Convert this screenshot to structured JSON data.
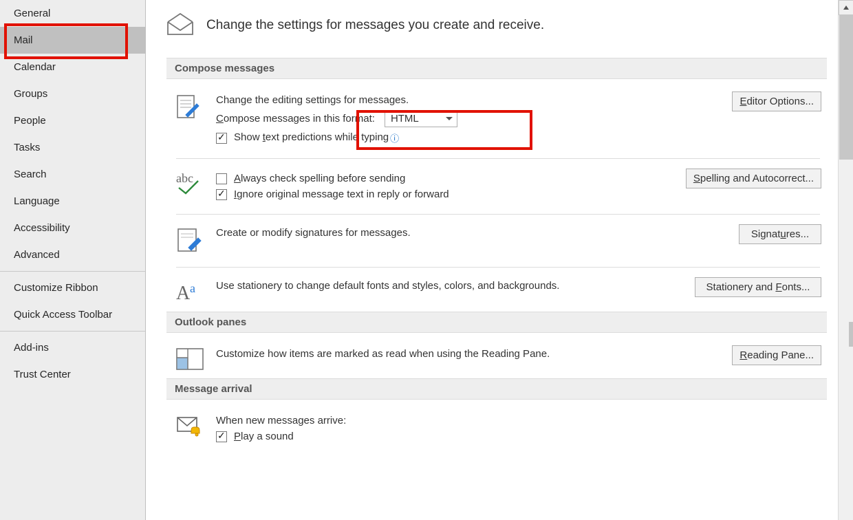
{
  "sidebar": {
    "items": [
      {
        "label": "General"
      },
      {
        "label": "Mail"
      },
      {
        "label": "Calendar"
      },
      {
        "label": "Groups"
      },
      {
        "label": "People"
      },
      {
        "label": "Tasks"
      },
      {
        "label": "Search"
      },
      {
        "label": "Language"
      },
      {
        "label": "Accessibility"
      },
      {
        "label": "Advanced"
      }
    ],
    "items2": [
      {
        "label": "Customize Ribbon"
      },
      {
        "label": "Quick Access Toolbar"
      }
    ],
    "items3": [
      {
        "label": "Add-ins"
      },
      {
        "label": "Trust Center"
      }
    ],
    "selected": "Mail"
  },
  "header": {
    "title": "Change the settings for messages you create and receive."
  },
  "sections": {
    "compose": {
      "title": "Compose messages",
      "editing_line": "Change the editing settings for messages.",
      "editor_btn": "Editor Options...",
      "format_label_pre": "C",
      "format_label_rest": "ompose messages in this format:",
      "format_value": "HTML",
      "predictions_label_pre": "Show ",
      "predictions_label_und": "t",
      "predictions_label_rest": "ext predictions while typing",
      "spell_check_und": "A",
      "spell_check_rest": "lways check spelling before sending",
      "spelling_btn_pre": "S",
      "spelling_btn_rest": "pelling and Autocorrect...",
      "ignore_und": "I",
      "ignore_rest": "gnore original message text in reply or forward",
      "signatures_line": "Create or modify signatures for messages.",
      "signatures_btn_pre": "Signat",
      "signatures_btn_und": "u",
      "signatures_btn_rest": "res...",
      "stationery_line": "Use stationery to change default fonts and styles, colors, and backgrounds.",
      "stationery_btn_pre": "Stationery and ",
      "stationery_btn_und": "F",
      "stationery_btn_rest": "onts..."
    },
    "panes": {
      "title": "Outlook panes",
      "line": "Customize how items are marked as read when using the Reading Pane.",
      "btn_und": "R",
      "btn_rest": "eading Pane..."
    },
    "arrival": {
      "title": "Message arrival",
      "line": "When new messages arrive:",
      "play_und": "P",
      "play_rest": "lay a sound"
    }
  },
  "checkboxes": {
    "predictions": true,
    "spell_check": false,
    "ignore_original": true,
    "play_sound": true
  }
}
